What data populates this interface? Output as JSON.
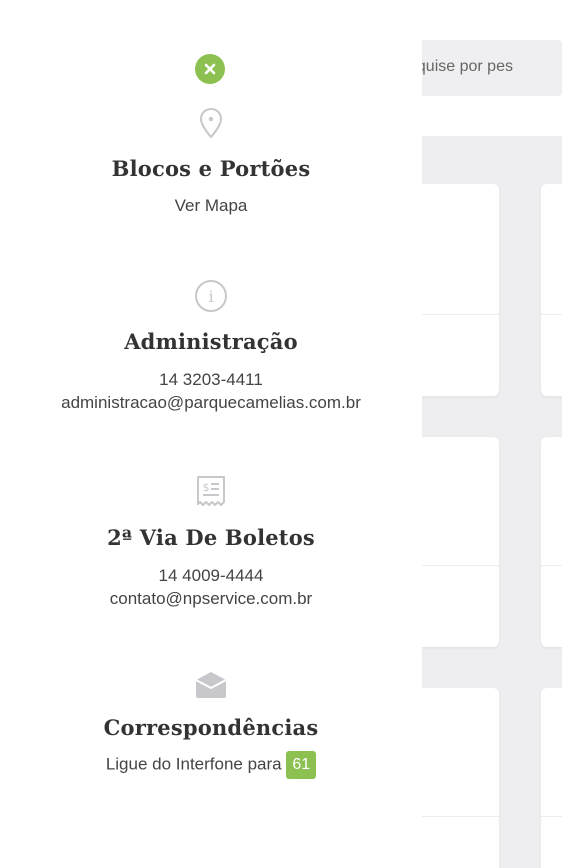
{
  "search": {
    "placeholder_visible": "esquise por pes"
  },
  "drawer": {
    "accent_color": "#8cc152",
    "close_icon": "close-icon",
    "sections": [
      {
        "icon": "location-pin-icon",
        "title": "Blocos e Portões",
        "link": "Ver Mapa"
      },
      {
        "icon": "info-icon",
        "title": "Administração",
        "phone": "14 3203-4411",
        "email": "administracao@parquecamelias.com.br"
      },
      {
        "icon": "receipt-icon",
        "title": "2ª Via De Boletos",
        "phone": "14 4009-4444",
        "email": "contato@npservice.com.br"
      },
      {
        "icon": "envelope-open-icon",
        "title": "Correspondências",
        "text": "Ligue do Interfone para",
        "badge": "61"
      }
    ]
  }
}
